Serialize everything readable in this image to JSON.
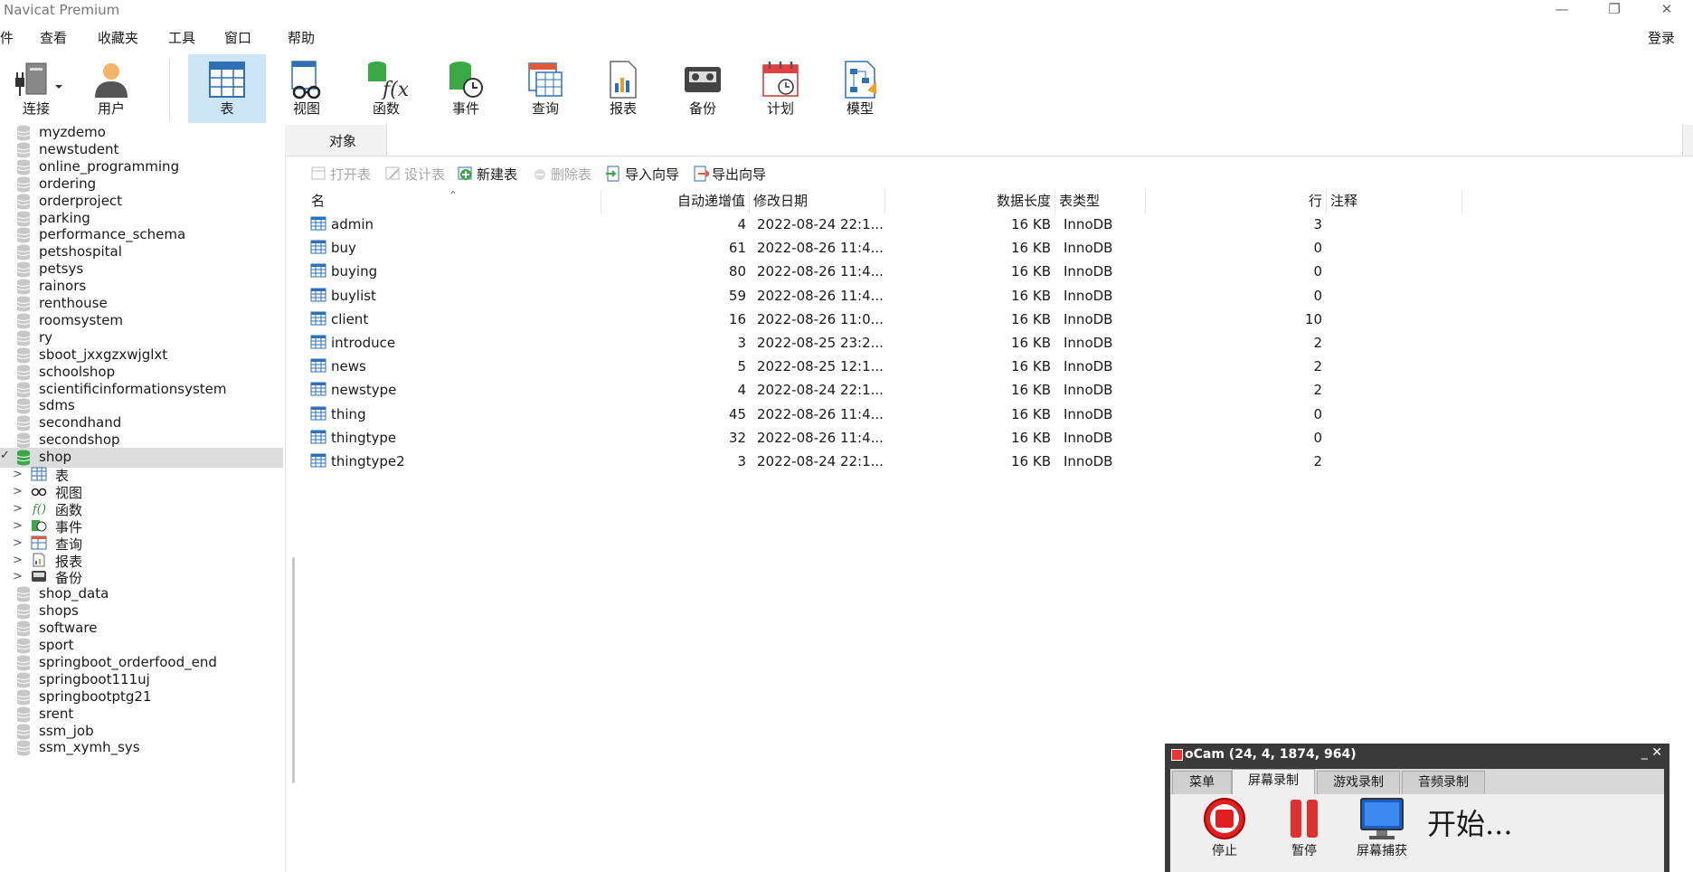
{
  "app": {
    "title": "Navicat Premium",
    "window_controls": [
      "—",
      "❐",
      "✕"
    ]
  },
  "menu": {
    "items": [
      "件",
      "查看",
      "收藏夹",
      "工具",
      "窗口",
      "帮助"
    ],
    "login": "登录"
  },
  "toolbar": {
    "items": [
      {
        "label": "连接",
        "icon": "connection-icon"
      },
      {
        "label": "用户",
        "icon": "user-icon"
      },
      {
        "label": "表",
        "icon": "table-icon",
        "active": true
      },
      {
        "label": "视图",
        "icon": "view-icon"
      },
      {
        "label": "函数",
        "icon": "function-icon"
      },
      {
        "label": "事件",
        "icon": "event-icon"
      },
      {
        "label": "查询",
        "icon": "query-icon"
      },
      {
        "label": "报表",
        "icon": "report-icon"
      },
      {
        "label": "备份",
        "icon": "backup-icon"
      },
      {
        "label": "计划",
        "icon": "schedule-icon"
      },
      {
        "label": "模型",
        "icon": "model-icon"
      }
    ]
  },
  "sidebar": {
    "databases_before": [
      "myzdemo",
      "newstudent",
      "online_programming",
      "ordering",
      "orderproject",
      "parking",
      "performance_schema",
      "petshospital",
      "petsys",
      "rainors",
      "renthouse",
      "roomsystem",
      "ry",
      "sboot_jxxgzxwjglxt",
      "schoolshop",
      "scientificinformationsystem",
      "sdms",
      "secondhand",
      "secondshop"
    ],
    "selected": "shop",
    "children": [
      "表",
      "视图",
      "函数",
      "事件",
      "查询",
      "报表",
      "备份"
    ],
    "databases_after": [
      "shop_data",
      "shops",
      "software",
      "sport",
      "springboot_orderfood_end",
      "springboot111uj",
      "springbootptg21",
      "srent",
      "ssm_job",
      "ssm_xymh_sys"
    ]
  },
  "tabs": {
    "object_tab": "对象"
  },
  "object_toolbar": {
    "open": "打开表",
    "design": "设计表",
    "new": "新建表",
    "delete": "删除表",
    "import": "导入向导",
    "export": "导出向导"
  },
  "grid": {
    "columns": [
      "名",
      "自动递增值",
      "修改日期",
      "数据长度",
      "表类型",
      "行",
      "注释"
    ],
    "rows": [
      [
        "admin",
        "4",
        "2022-08-24 22:1...",
        "16 KB",
        "InnoDB",
        "3",
        ""
      ],
      [
        "buy",
        "61",
        "2022-08-26 11:4...",
        "16 KB",
        "InnoDB",
        "0",
        ""
      ],
      [
        "buying",
        "80",
        "2022-08-26 11:4...",
        "16 KB",
        "InnoDB",
        "0",
        ""
      ],
      [
        "buylist",
        "59",
        "2022-08-26 11:4...",
        "16 KB",
        "InnoDB",
        "0",
        ""
      ],
      [
        "client",
        "16",
        "2022-08-26 11:0...",
        "16 KB",
        "InnoDB",
        "10",
        ""
      ],
      [
        "introduce",
        "3",
        "2022-08-25 23:2...",
        "16 KB",
        "InnoDB",
        "2",
        ""
      ],
      [
        "news",
        "5",
        "2022-08-25 12:1...",
        "16 KB",
        "InnoDB",
        "2",
        ""
      ],
      [
        "newstype",
        "4",
        "2022-08-24 22:1...",
        "16 KB",
        "InnoDB",
        "2",
        ""
      ],
      [
        "thing",
        "45",
        "2022-08-26 11:4...",
        "16 KB",
        "InnoDB",
        "0",
        ""
      ],
      [
        "thingtype",
        "32",
        "2022-08-26 11:4...",
        "16 KB",
        "InnoDB",
        "0",
        ""
      ],
      [
        "thingtype2",
        "3",
        "2022-08-24 22:1...",
        "16 KB",
        "InnoDB",
        "2",
        ""
      ]
    ]
  },
  "ocam": {
    "title": "oCam (24, 4, 1874, 964)",
    "controls": "_ ✕",
    "tabs": [
      "菜单",
      "屏幕录制",
      "游戏录制",
      "音频录制"
    ],
    "buttons": [
      "停止",
      "暂停",
      "屏幕捕获"
    ],
    "status": "开始..."
  },
  "colors": {
    "active_toolbar": "#cde6f7",
    "selected_row": "#dcdcdc",
    "db_icon": "#c8c8c8",
    "db_icon_active": "#3aa845"
  }
}
